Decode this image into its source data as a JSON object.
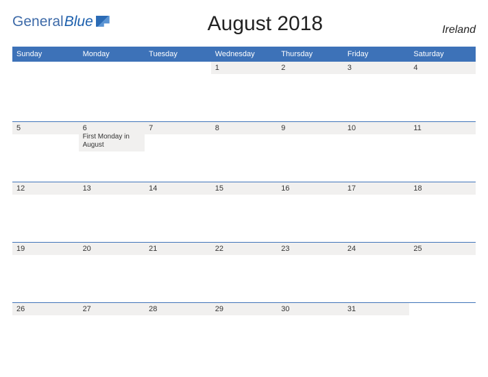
{
  "logo": {
    "general": "General",
    "blue": "Blue"
  },
  "title": "August 2018",
  "region": "Ireland",
  "dayHeaders": [
    "Sunday",
    "Monday",
    "Tuesday",
    "Wednesday",
    "Thursday",
    "Friday",
    "Saturday"
  ],
  "weeks": [
    [
      {
        "day": "",
        "event": ""
      },
      {
        "day": "",
        "event": ""
      },
      {
        "day": "",
        "event": ""
      },
      {
        "day": "1",
        "event": ""
      },
      {
        "day": "2",
        "event": ""
      },
      {
        "day": "3",
        "event": ""
      },
      {
        "day": "4",
        "event": ""
      }
    ],
    [
      {
        "day": "5",
        "event": ""
      },
      {
        "day": "6",
        "event": "First Monday in August"
      },
      {
        "day": "7",
        "event": ""
      },
      {
        "day": "8",
        "event": ""
      },
      {
        "day": "9",
        "event": ""
      },
      {
        "day": "10",
        "event": ""
      },
      {
        "day": "11",
        "event": ""
      }
    ],
    [
      {
        "day": "12",
        "event": ""
      },
      {
        "day": "13",
        "event": ""
      },
      {
        "day": "14",
        "event": ""
      },
      {
        "day": "15",
        "event": ""
      },
      {
        "day": "16",
        "event": ""
      },
      {
        "day": "17",
        "event": ""
      },
      {
        "day": "18",
        "event": ""
      }
    ],
    [
      {
        "day": "19",
        "event": ""
      },
      {
        "day": "20",
        "event": ""
      },
      {
        "day": "21",
        "event": ""
      },
      {
        "day": "22",
        "event": ""
      },
      {
        "day": "23",
        "event": ""
      },
      {
        "day": "24",
        "event": ""
      },
      {
        "day": "25",
        "event": ""
      }
    ],
    [
      {
        "day": "26",
        "event": ""
      },
      {
        "day": "27",
        "event": ""
      },
      {
        "day": "28",
        "event": ""
      },
      {
        "day": "29",
        "event": ""
      },
      {
        "day": "30",
        "event": ""
      },
      {
        "day": "31",
        "event": ""
      },
      {
        "day": "",
        "event": ""
      }
    ]
  ]
}
